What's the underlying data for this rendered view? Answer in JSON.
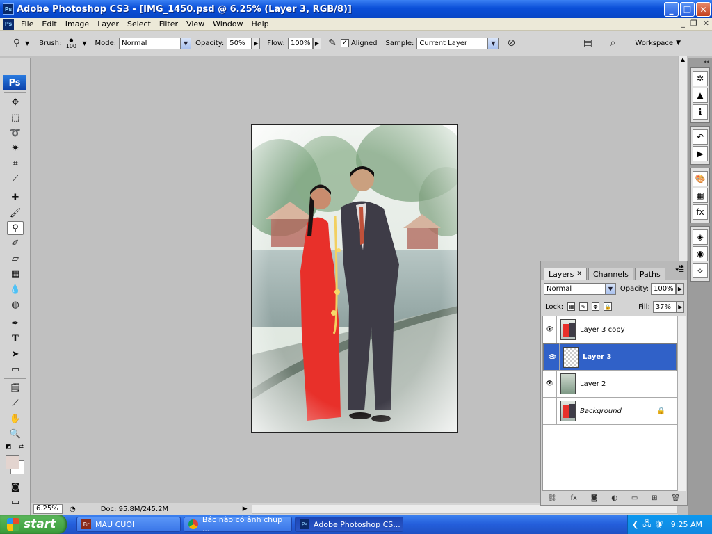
{
  "window": {
    "title": "Adobe Photoshop CS3 - [IMG_1450.psd @ 6.25% (Layer 3, RGB/8)]",
    "app_icon": "Ps"
  },
  "menu": [
    "File",
    "Edit",
    "Image",
    "Layer",
    "Select",
    "Filter",
    "View",
    "Window",
    "Help"
  ],
  "options": {
    "brush_label": "Brush:",
    "brush_size": "100",
    "mode_label": "Mode:",
    "mode_value": "Normal",
    "opacity_label": "Opacity:",
    "opacity_value": "50%",
    "flow_label": "Flow:",
    "flow_value": "100%",
    "aligned_label": "Aligned",
    "sample_label": "Sample:",
    "sample_value": "Current Layer",
    "workspace_label": "Workspace"
  },
  "toolbox": {
    "logo": "Ps"
  },
  "status": {
    "zoom": "6.25%",
    "doc": "Doc: 95.8M/245.2M"
  },
  "layers_panel": {
    "tabs": [
      "Layers",
      "Channels",
      "Paths"
    ],
    "blend_mode": "Normal",
    "opacity_label": "Opacity:",
    "opacity_value": "100%",
    "lock_label": "Lock:",
    "fill_label": "Fill:",
    "fill_value": "37%",
    "layers": [
      {
        "name": "Layer 3 copy",
        "visible": true,
        "selected": false
      },
      {
        "name": "Layer 3",
        "visible": true,
        "selected": true
      },
      {
        "name": "Layer 2",
        "visible": true,
        "selected": false
      },
      {
        "name": "Background",
        "visible": false,
        "selected": false,
        "locked": true
      }
    ]
  },
  "taskbar": {
    "start": "start",
    "tasks": [
      {
        "label": "MAU CUOI",
        "icon": "Br"
      },
      {
        "label": "Bác nào có ảnh chụp ...",
        "icon": "chrome"
      },
      {
        "label": "Adobe Photoshop CS...",
        "icon": "Ps"
      }
    ],
    "clock": "9:25 AM"
  },
  "colors": {
    "title_blue": "#0a4fd8",
    "selected_layer": "#3061c8",
    "taskbar": "#245edb",
    "start_green": "#3a9c3a"
  }
}
